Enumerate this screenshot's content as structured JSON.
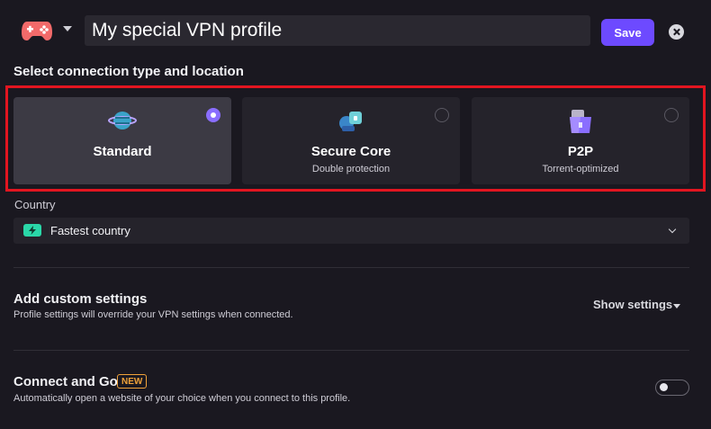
{
  "header": {
    "profile_icon": "gamepad-icon",
    "profile_name": "My special VPN profile",
    "save_label": "Save",
    "close_icon": "close-icon"
  },
  "connection": {
    "section_title": "Select connection type and location",
    "cards": [
      {
        "title": "Standard",
        "subtitle": "",
        "icon": "globe-icon",
        "selected": true
      },
      {
        "title": "Secure Core",
        "subtitle": "Double protection",
        "icon": "secure-core-icon",
        "selected": false
      },
      {
        "title": "P2P",
        "subtitle": "Torrent-optimized",
        "icon": "p2p-icon",
        "selected": false
      }
    ]
  },
  "country": {
    "label": "Country",
    "selected": "Fastest country",
    "icon": "bolt-icon"
  },
  "custom_settings": {
    "title": "Add custom settings",
    "description": "Profile settings will override your VPN settings when connected.",
    "show_settings_label": "Show settings"
  },
  "connect_and_go": {
    "title": "Connect and Go",
    "badge": "NEW",
    "description": "Automatically open a website of your choice when you connect to this profile.",
    "enabled": false
  },
  "colors": {
    "background": "#1a1820",
    "accent": "#6d4aff",
    "highlight": "#e21520",
    "new_badge": "#f0a23a"
  }
}
